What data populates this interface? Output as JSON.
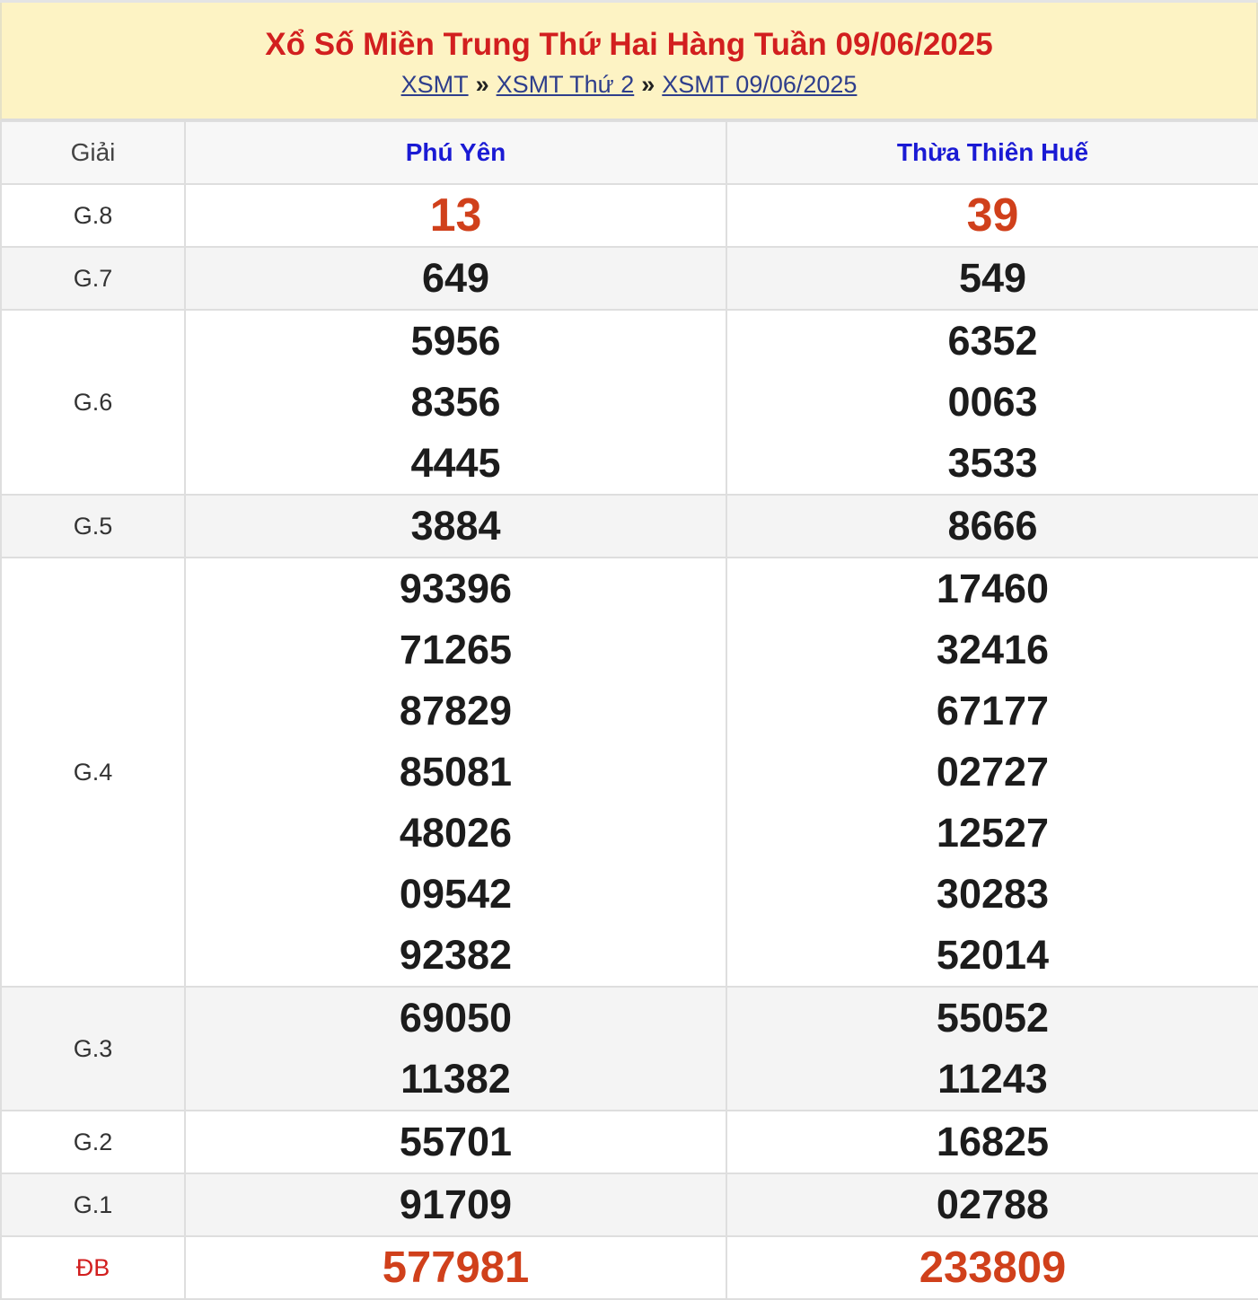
{
  "header": {
    "title": "Xổ Số Miền Trung Thứ Hai Hàng Tuần 09/06/2025",
    "breadcrumb": [
      {
        "label": "XSMT"
      },
      {
        "label": "XSMT Thứ 2"
      },
      {
        "label": "XSMT 09/06/2025"
      }
    ],
    "separator": "»"
  },
  "table": {
    "columns": [
      "Giải",
      "Phú Yên",
      "Thừa Thiên Huế"
    ],
    "rows": [
      {
        "prize": "G.8",
        "phu_yen": [
          "13"
        ],
        "hue": [
          "39"
        ]
      },
      {
        "prize": "G.7",
        "phu_yen": [
          "649"
        ],
        "hue": [
          "549"
        ]
      },
      {
        "prize": "G.6",
        "phu_yen": [
          "5956",
          "8356",
          "4445"
        ],
        "hue": [
          "6352",
          "0063",
          "3533"
        ]
      },
      {
        "prize": "G.5",
        "phu_yen": [
          "3884"
        ],
        "hue": [
          "8666"
        ]
      },
      {
        "prize": "G.4",
        "phu_yen": [
          "93396",
          "71265",
          "87829",
          "85081",
          "48026",
          "09542",
          "92382"
        ],
        "hue": [
          "17460",
          "32416",
          "67177",
          "02727",
          "12527",
          "30283",
          "52014"
        ]
      },
      {
        "prize": "G.3",
        "phu_yen": [
          "69050",
          "11382"
        ],
        "hue": [
          "55052",
          "11243"
        ]
      },
      {
        "prize": "G.2",
        "phu_yen": [
          "55701"
        ],
        "hue": [
          "16825"
        ]
      },
      {
        "prize": "G.1",
        "phu_yen": [
          "91709"
        ],
        "hue": [
          "02788"
        ]
      },
      {
        "prize": "ĐB",
        "phu_yen": [
          "577981"
        ],
        "hue": [
          "233809"
        ]
      }
    ]
  },
  "colors": {
    "header_bg": "#fdf3c4",
    "title": "#d21f1f",
    "column_header": "#1a1ad4",
    "highlight_number": "#d0401b"
  }
}
